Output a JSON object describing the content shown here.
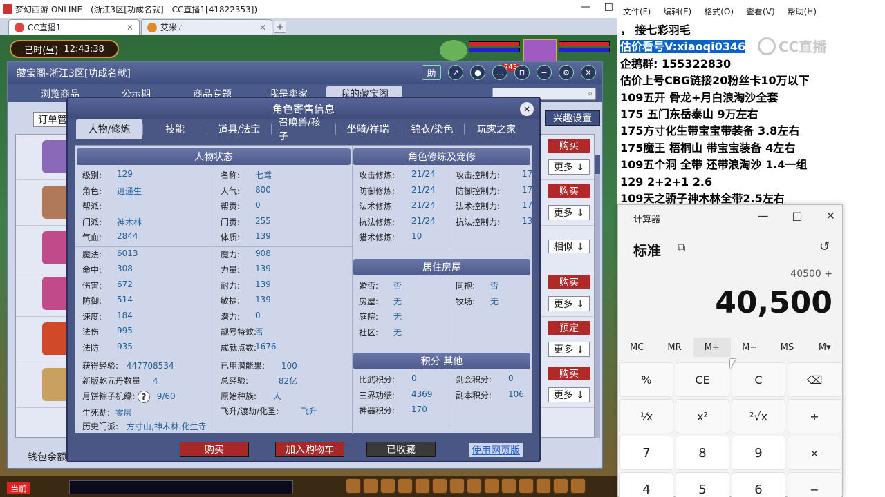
{
  "browser": {
    "window_title": "梦幻西游 ONLINE - (浙江3区[功成名就] - CC直播1[41822353])",
    "tabs": [
      {
        "label": "CC直播1",
        "active": true
      },
      {
        "label": "艾米∵",
        "active": false
      }
    ],
    "new_tab": "+",
    "min": "—",
    "max": "□",
    "close": "×"
  },
  "game_hud": {
    "clock_label": "已时(昼)",
    "clock_time": "12:43:38"
  },
  "store": {
    "title": "藏宝阁-浙江3区[功成名就]",
    "help": "助",
    "badge": "743",
    "nav": [
      "浏览商品",
      "公示期",
      "商品专题",
      "我是卖家",
      "我的藏宝阁"
    ],
    "nav_active": 4,
    "order_button": "订单管",
    "hobby_button": "兴趣设置",
    "rows": [
      {
        "action": "购买",
        "more": "更多 ↓",
        "color": "#b02a2a"
      },
      {
        "action": "购买",
        "more": "更多 ↓",
        "color": "#b02a2a"
      },
      {
        "action": "相似 ↓",
        "more": "",
        "color": "#ffffff"
      },
      {
        "action": "购买",
        "more": "更多 ↓",
        "color": "#b02a2a"
      },
      {
        "action": "预定",
        "more": "更多 ↓",
        "color": "#b02a2a"
      },
      {
        "action": "购买",
        "more": "更多 ↓",
        "color": "#b02a2a"
      }
    ],
    "wallet": "钱包余额"
  },
  "bottom": {
    "current": "当前"
  },
  "dialog": {
    "title": "角色寄售信息",
    "close": "×",
    "tabs": [
      "人物/修炼",
      "技能",
      "道具/法宝",
      "召唤兽/孩子",
      "坐骑/祥瑞",
      "锦衣/染色",
      "玩家之家"
    ],
    "active_tab": 0,
    "status_title": "人物状态",
    "status_left": [
      {
        "k": "级别:",
        "v": "129"
      },
      {
        "k": "角色:",
        "v": "逍遥生"
      },
      {
        "k": "帮派:",
        "v": ""
      },
      {
        "k": "门派:",
        "v": "神木林"
      },
      {
        "k": "气血:",
        "v": "2844"
      },
      {
        "k": "魔法:",
        "v": "6013"
      },
      {
        "k": "命中:",
        "v": "308"
      },
      {
        "k": "伤害:",
        "v": "672"
      },
      {
        "k": "防御:",
        "v": "514"
      },
      {
        "k": "速度:",
        "v": "184"
      },
      {
        "k": "法伤",
        "v": "995"
      },
      {
        "k": "法防",
        "v": "935"
      }
    ],
    "status_right": [
      {
        "k": "名称:",
        "v": "七鸢"
      },
      {
        "k": "人气:",
        "v": "800"
      },
      {
        "k": "帮贡:",
        "v": "0"
      },
      {
        "k": "门贡:",
        "v": "255"
      },
      {
        "k": "体质:",
        "v": "139"
      },
      {
        "k": "魔力:",
        "v": "908"
      },
      {
        "k": "力量:",
        "v": "139"
      },
      {
        "k": "耐力:",
        "v": "139"
      },
      {
        "k": "敏捷:",
        "v": "139"
      },
      {
        "k": "潜力:",
        "v": "0"
      },
      {
        "k": "靓号特效:",
        "v": "否"
      },
      {
        "k": "成就点数:",
        "v": "1676"
      }
    ],
    "extra": {
      "exp_label": "获得经验:",
      "exp_value": "447708534",
      "potion_label": "新版乾元丹数量",
      "potion_value": "4",
      "zongzi_label": "月饼粽子机缘:",
      "zongzi_value": "9/60",
      "qmark": "?",
      "shengsi_label": "生死劫:",
      "shengsi_value": "零层",
      "history_label": "历史门派:",
      "history_value": "方寸山,神木林,化生寺",
      "used_label": "已用潜能果:",
      "used_value": "100",
      "total_label": "总经验:",
      "total_value": "82亿",
      "race_label": "原始种族:",
      "race_value": "人",
      "fly_label": "飞升/渡劫/化圣:",
      "fly_value": "飞升"
    },
    "cult_title": "角色修炼及宠修",
    "cult_left": [
      {
        "k": "攻击修炼:",
        "v": "21/24"
      },
      {
        "k": "防御修炼:",
        "v": "21/24"
      },
      {
        "k": "法术修炼",
        "v": "21/24"
      },
      {
        "k": "抗法修炼:",
        "v": "21/24"
      },
      {
        "k": "猎术修炼:",
        "v": "10"
      }
    ],
    "cult_right": [
      {
        "k": "攻击控制力:",
        "v": "17"
      },
      {
        "k": "防御控制力:",
        "v": "17"
      },
      {
        "k": "法术控制力:",
        "v": "17"
      },
      {
        "k": "抗法控制力:",
        "v": "13"
      }
    ],
    "house_title": "居住房屋",
    "house_left": [
      {
        "k": "婚否:",
        "v": "否"
      },
      {
        "k": "房屋:",
        "v": "无"
      },
      {
        "k": "庭院:",
        "v": "无"
      },
      {
        "k": "社区:",
        "v": "无"
      }
    ],
    "house_right": [
      {
        "k": "同袍:",
        "v": "否"
      },
      {
        "k": "牧场:",
        "v": "无"
      }
    ],
    "score_title": "积分 其他",
    "score_left": [
      {
        "k": "比武积分:",
        "v": "0"
      },
      {
        "k": "三界功绩:",
        "v": "4369"
      },
      {
        "k": "神器积分:",
        "v": "170"
      }
    ],
    "score_right": [
      {
        "k": "剑会积分:",
        "v": "0"
      },
      {
        "k": "副本积分:",
        "v": "106"
      }
    ],
    "buttons": {
      "buy": "购买",
      "cart": "加入购物车",
      "fav": "已收藏",
      "web": "使用网页版"
    }
  },
  "notepad": {
    "menu": [
      "文件(F)",
      "编辑(E)",
      "格式(O)",
      "查看(V)",
      "帮助(H)"
    ],
    "lines": [
      "，     接七彩羽毛",
      "估价看号V:xiaoqi0346",
      "企鹅群:  155322830",
      "估价上号CBG链接20粉丝卡10万以下",
      "109五开 骨龙+月白浪淘沙全套",
      "175 五门东岳泰山  9万左右",
      "175方寸化生带宝宝带装备  3.8左右",
      "175魔王 梧桐山  带宝宝装备 4左右",
      "109五个洞 全带 还带浪淘沙  1.4一组",
      "129 2+2+1  2.6",
      "109天之骄子神木林全带2.5左右"
    ],
    "highlight_line": 1,
    "watermark": "CC直播"
  },
  "calculator": {
    "title": "计算器",
    "min": "—",
    "max": "□",
    "close": "✕",
    "mode": "标准",
    "mode_icon": "⧉",
    "history_icon": "↺",
    "expression": "40500 +",
    "display": "40,500",
    "memory": [
      "MC",
      "MR",
      "M+",
      "M−",
      "MS",
      "M▾"
    ],
    "memory_selected": 2,
    "keys": [
      "%",
      "CE",
      "C",
      "⌫",
      "⅟x",
      "x²",
      "²√x",
      "÷",
      "7",
      "8",
      "9",
      "×",
      "4",
      "5",
      "6",
      "−"
    ]
  }
}
